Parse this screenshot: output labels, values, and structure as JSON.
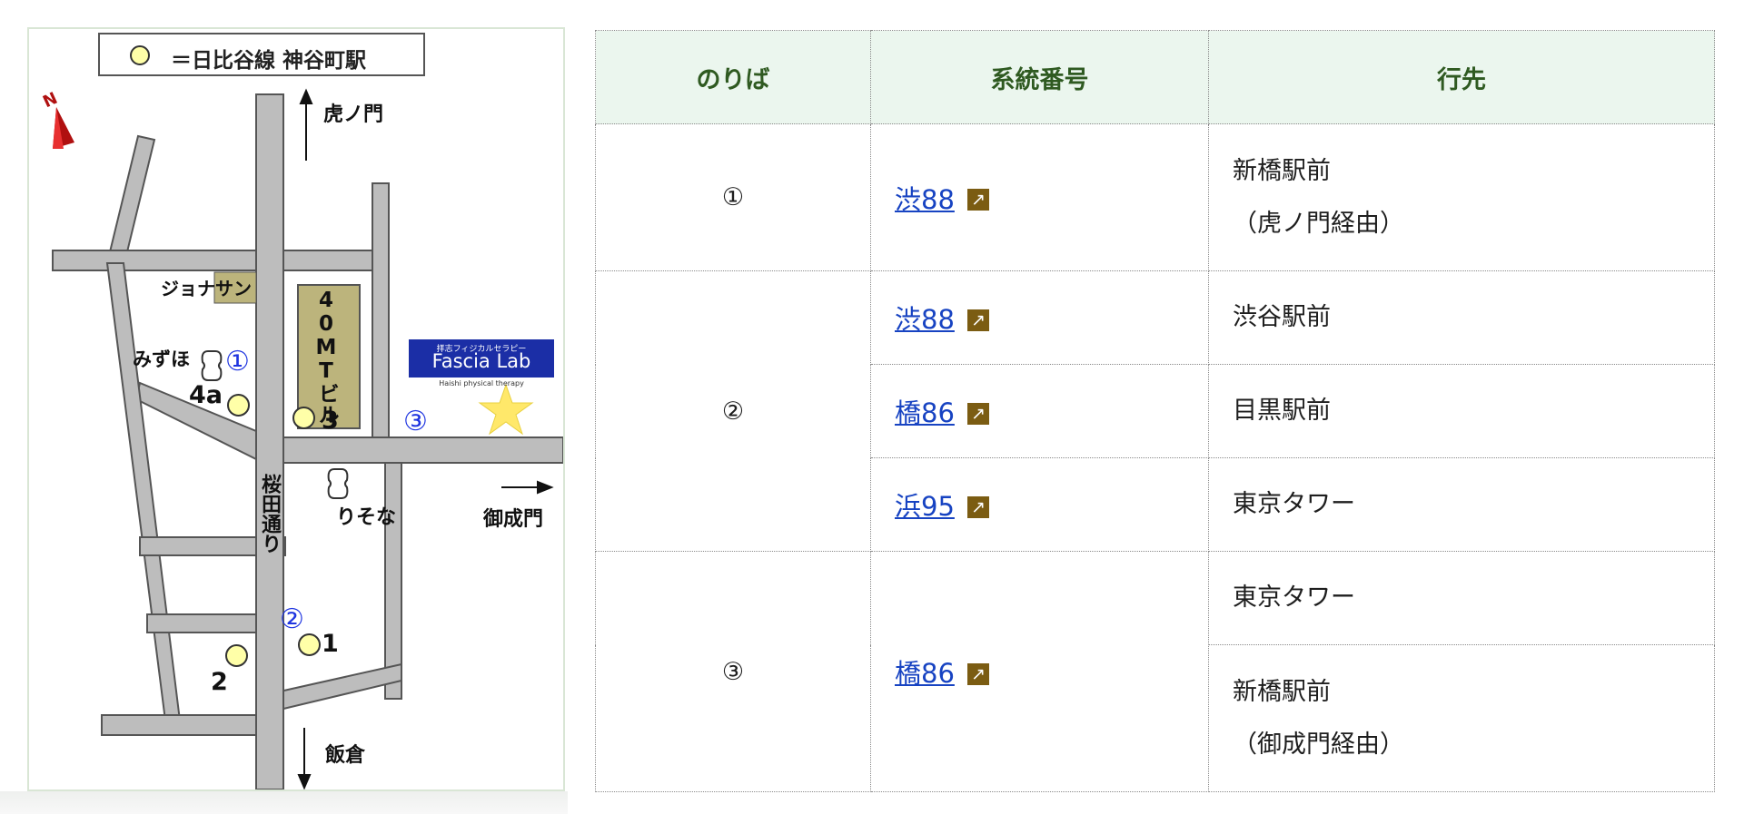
{
  "map": {
    "legend": "＝日比谷線 神谷町駅",
    "north": "N",
    "labels": {
      "toranomon": "虎ノ門",
      "jonathan": "ジョナサン",
      "mizuho": "みずほ",
      "building": "40MTビル",
      "sakurada": "桜田通り",
      "risona": "りそな",
      "onarimon": "御成門",
      "iikura": "飯倉"
    },
    "exits": {
      "e4a": "4a",
      "e3": "3",
      "e1": "1",
      "e2": "2"
    },
    "stops": {
      "s1": "①",
      "s2": "②",
      "s3": "③"
    },
    "logo": {
      "small": "拝志フィジカルセラピー",
      "main": "Fascia Lab",
      "sub": "Haishi physical therapy"
    }
  },
  "table": {
    "headers": {
      "stop": "のりば",
      "route": "系統番号",
      "dest": "行先"
    },
    "rows": [
      {
        "stop": "①",
        "route": "渋88",
        "dest1": "新橋駅前",
        "dest2": "（虎ノ門経由）"
      },
      {
        "stop": "②",
        "route": "渋88",
        "dest1": "渋谷駅前"
      },
      {
        "route": "橋86",
        "dest1": "目黒駅前"
      },
      {
        "route": "浜95",
        "dest1": "東京タワー"
      },
      {
        "stop": "③",
        "route": "橋86",
        "dest1": "東京タワー"
      },
      {
        "dest1": "新橋駅前",
        "dest2": "（御成門経由）"
      }
    ],
    "ext_icon": "↗"
  },
  "colors": {
    "header_bg": "#ebf6ee",
    "header_text": "#2f5a21",
    "link": "#1743c2",
    "stop_circle": "#1f2fd8",
    "ext_icon_bg": "#7b5c12",
    "road": "#bdbdbd",
    "building": "#bcb47c",
    "logo_bg": "#1b2ea6"
  }
}
